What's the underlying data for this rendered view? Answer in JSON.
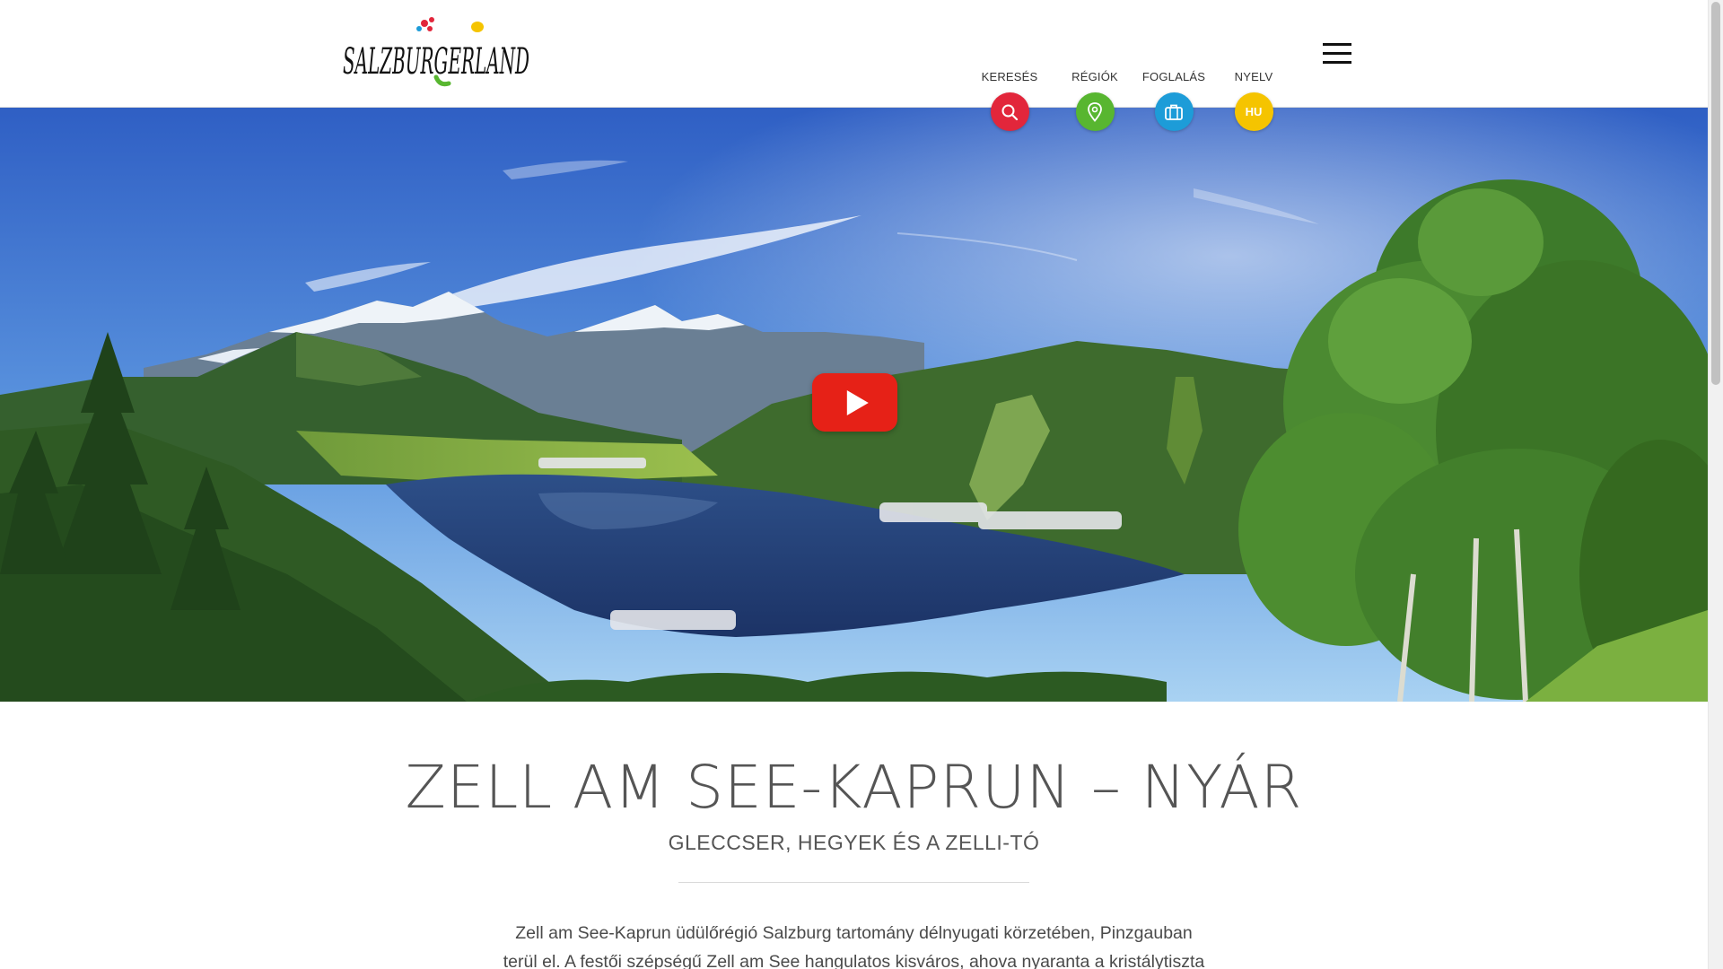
{
  "brand": {
    "logo_text": "SALZBURGERLAND"
  },
  "nav": {
    "items": [
      {
        "label": "KERESÉS",
        "icon": "search-icon",
        "color": "#e2263b"
      },
      {
        "label": "RÉGIÓK",
        "icon": "map-pin-icon",
        "color": "#58b630"
      },
      {
        "label": "FOGLALÁS",
        "icon": "suitcase-icon",
        "color": "#1d9cd8"
      },
      {
        "label": "NYELV",
        "icon": "language-icon",
        "color": "#f5c400",
        "code": "HU"
      }
    ],
    "menu_icon": "hamburger-menu-icon"
  },
  "hero": {
    "play_icon": "play-icon",
    "play_color": "#e62117"
  },
  "main": {
    "title": "ZELL AM SEE-KAPRUN – NYÁR",
    "subtitle": "GLECCSER, HEGYEK ÉS A ZELLI-TÓ",
    "intro_line1": "Zell am See-Kaprun üdülőrégió Salzburg tartomány délnyugati körzetében, Pinzgauban",
    "intro_line2": "terül el. A festői szépségű Zell am See hangulatos kisváros, ahova nyaranta a kristálytiszta"
  }
}
